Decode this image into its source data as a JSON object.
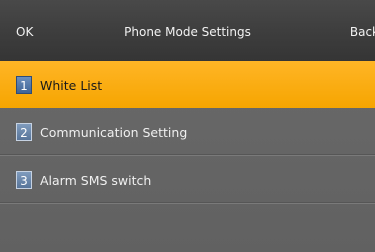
{
  "header": {
    "ok_label": "OK",
    "title": "Phone Mode Settings",
    "back_label": "Back"
  },
  "menu": {
    "items": [
      {
        "number": "1",
        "label": "White List",
        "selected": true
      },
      {
        "number": "2",
        "label": "Communication Setting",
        "selected": false
      },
      {
        "number": "3",
        "label": "Alarm SMS switch",
        "selected": false
      }
    ]
  },
  "colors": {
    "highlight": "#f9aa0a",
    "background": "#666666",
    "titlebar": "#3f3f3f",
    "number_badge": "#6a87ad"
  }
}
